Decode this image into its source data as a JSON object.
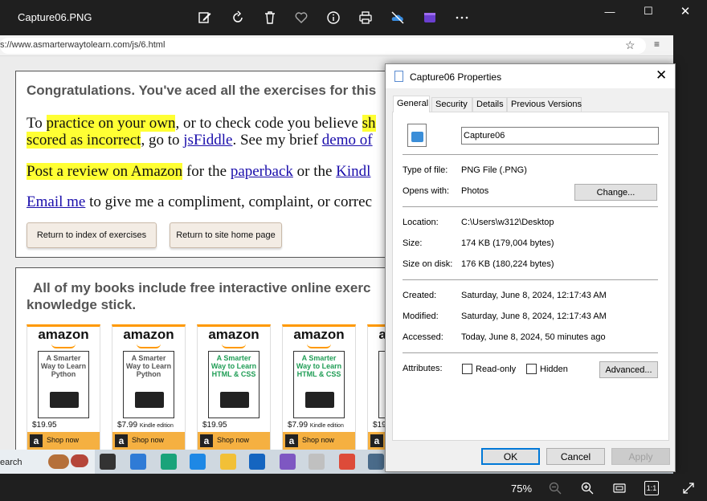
{
  "app": {
    "title": "Capture06.PNG",
    "zoom": "75%",
    "actual_size_label": "1:1",
    "toolbar_icons": [
      "edit-icon",
      "rotate-icon",
      "delete-icon",
      "favorite-icon",
      "info-icon",
      "print-icon",
      "onedrive-icon",
      "clipchamp-icon",
      "more-icon"
    ],
    "window_controls": [
      "minimize",
      "maximize",
      "close"
    ]
  },
  "screenshot": {
    "url": "s://www.asmarterwaytolearn.com/js/6.html",
    "congrats_heading": "Congratulations. You've aced all the exercises for this",
    "para1_prefix": "To ",
    "para1_hl1": "practice on your own",
    "para1_mid": ", or to check code you believe ",
    "para1_hl2": "sh",
    "para1_line2_hl": "scored as incorrect",
    "para1_line2_mid": ", go to ",
    "para1_line2_link1": "jsFiddle",
    "para1_line2_tail": ". See my brief ",
    "para1_line2_link2": "demo of",
    "para2_hl": "Post a review on Amazon",
    "para2_mid": " for the ",
    "para2_link1": "paperback",
    "para2_mid2": " or the ",
    "para2_link2": "Kindl",
    "para3_link": "Email me",
    "para3_tail": " to give me a compliment, complaint, or correc",
    "btn_index": "Return to index of exercises",
    "btn_home": "Return to site home page",
    "books_heading_l1": "All of my books include free interactive online exerc",
    "books_heading_l2": "knowledge stick.",
    "books": [
      {
        "brand": "amazon",
        "title": "A Smarter Way to Learn Python",
        "price": "$19.95",
        "edition": "",
        "shop": "Shop now",
        "color": "#555555"
      },
      {
        "brand": "amazon",
        "title": "A Smarter Way to Learn Python",
        "price": "$7.99",
        "edition": "Kindle edition",
        "shop": "Shop now",
        "color": "#555555"
      },
      {
        "brand": "amazon",
        "title": "A Smarter Way to Learn HTML & CSS",
        "price": "$19.95",
        "edition": "",
        "shop": "Shop now",
        "color": "#1f9d55"
      },
      {
        "brand": "amazon",
        "title": "A Smarter Way to Learn HTML & CSS",
        "price": "$7.99",
        "edition": "Kindle edition",
        "shop": "Shop now",
        "color": "#1f9d55"
      },
      {
        "brand": "amazon",
        "title": "",
        "price": "$19",
        "edition": "",
        "shop": "",
        "color": "#555555"
      }
    ],
    "taskbar_search": "earch",
    "taskbar_apps": [
      {
        "name": "task-view",
        "color": "#333333"
      },
      {
        "name": "store",
        "color": "#2f7bd6"
      },
      {
        "name": "edge",
        "color": "#1aa37a"
      },
      {
        "name": "vscode",
        "color": "#1e88e5"
      },
      {
        "name": "file-explorer",
        "color": "#f2c037"
      },
      {
        "name": "mail",
        "color": "#1565c0"
      },
      {
        "name": "copilot",
        "color": "#7e57c2"
      },
      {
        "name": "snipping",
        "color": "#c0c0c0"
      },
      {
        "name": "chrome",
        "color": "#dd4b39"
      },
      {
        "name": "calculator",
        "color": "#4a6b8a"
      }
    ]
  },
  "dialog": {
    "title": "Capture06 Properties",
    "tabs": [
      "General",
      "Security",
      "Details",
      "Previous Versions"
    ],
    "active_tab": "General",
    "file_name": "Capture06",
    "rows": {
      "type_label": "Type of file:",
      "type_value": "PNG File (.PNG)",
      "opens_label": "Opens with:",
      "opens_value": "Photos",
      "change_button": "Change...",
      "location_label": "Location:",
      "location_value": "C:\\Users\\w312\\Desktop",
      "size_label": "Size:",
      "size_value": "174 KB (179,004 bytes)",
      "disk_label": "Size on disk:",
      "disk_value": "176 KB (180,224 bytes)",
      "created_label": "Created:",
      "created_value": "Saturday, June 8, 2024, 12:17:43 AM",
      "modified_label": "Modified:",
      "modified_value": "Saturday, June 8, 2024, 12:17:43 AM",
      "accessed_label": "Accessed:",
      "accessed_value": "Today, June 8, 2024, 50 minutes ago",
      "attributes_label": "Attributes:",
      "readonly_label": "Read-only",
      "hidden_label": "Hidden",
      "advanced_button": "Advanced..."
    },
    "ok": "OK",
    "cancel": "Cancel",
    "apply": "Apply"
  }
}
